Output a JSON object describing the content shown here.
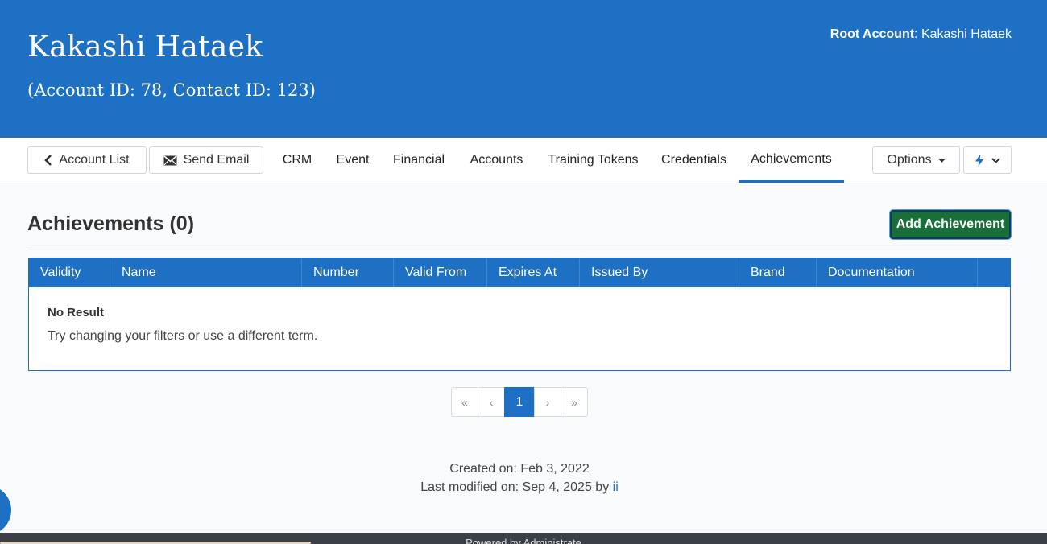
{
  "header": {
    "name": "Kakashi Hataek",
    "ids": "(Account ID: 78, Contact ID: 123)",
    "root_label": "Root Account",
    "root_value": ": Kakashi Hataek"
  },
  "nav": {
    "account_list": "Account List",
    "send_email": "Send Email",
    "tabs": [
      "CRM",
      "Event",
      "Financial",
      "Accounts",
      "Training Tokens",
      "Credentials",
      "Achievements"
    ],
    "active_tab": "Achievements",
    "options": "Options"
  },
  "section": {
    "title": "Achievements (0)",
    "add_button": "Add Achievement"
  },
  "table": {
    "columns": [
      "Validity",
      "Name",
      "Number",
      "Valid From",
      "Expires At",
      "Issued By",
      "Brand",
      "Documentation"
    ],
    "empty_title": "No Result",
    "empty_text": "Try changing your filters or use a different term."
  },
  "pagination": {
    "first": "«",
    "prev": "‹",
    "current": "1",
    "next": "›",
    "last": "»"
  },
  "meta": {
    "created": "Created on: Feb 3, 2022",
    "modified_prefix": "Last modified on: Sep 4, 2025 by ",
    "modified_by": "ii"
  },
  "footer": {
    "powered": "Powered by Administrate"
  },
  "colors": {
    "primary": "#1d70c4",
    "success": "#1a6e3a",
    "footer": "#3a4046"
  },
  "icons": {
    "account_list": "chevron-left-icon",
    "send_email": "envelope-icon",
    "options": "caret-down-icon",
    "quick": "bolt-icon"
  }
}
